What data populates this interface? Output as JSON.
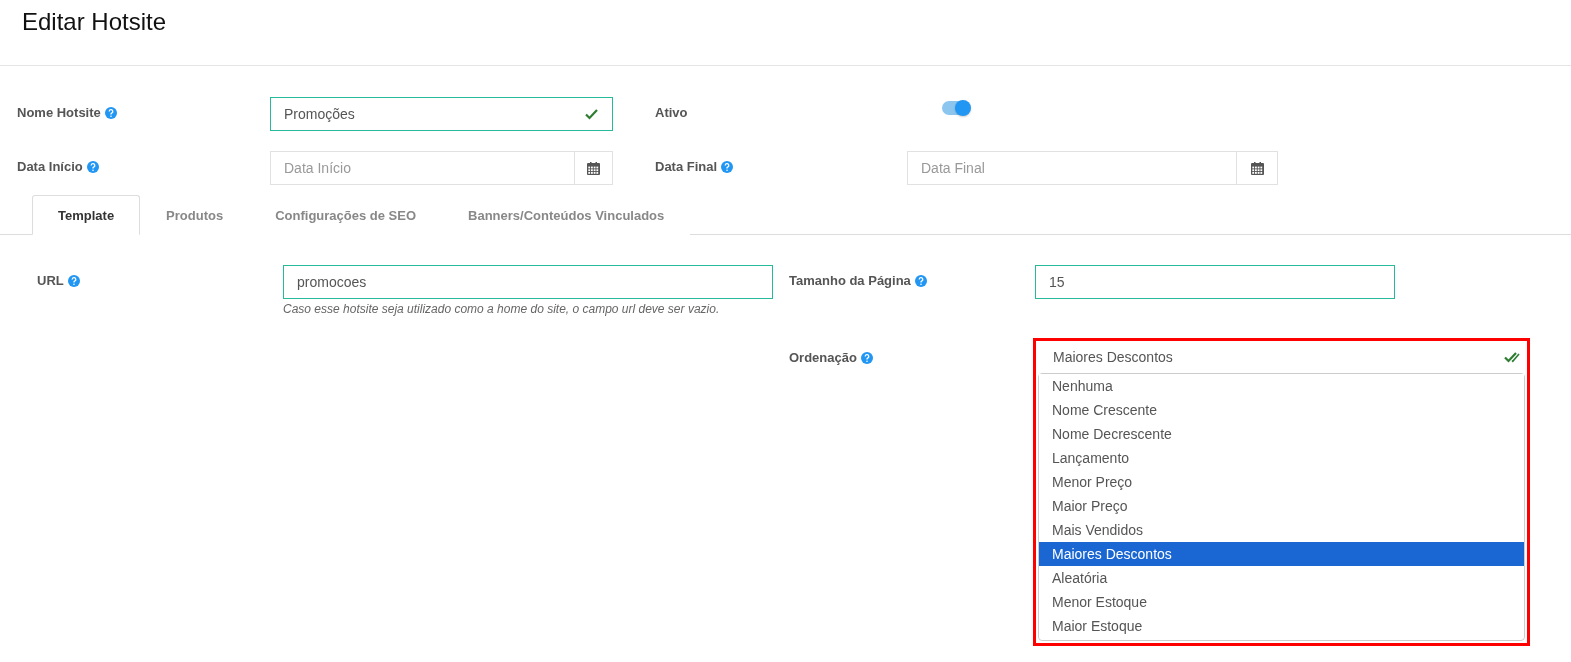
{
  "page_title": "Editar Hotsite",
  "fields": [
    {
      "kind": "text",
      "label": "Nome Hotsite",
      "help": true,
      "value": "Promoções",
      "valid": true
    },
    {
      "kind": "switch",
      "label": "Ativo",
      "help": false,
      "on": true
    },
    {
      "kind": "date",
      "label": "Data Início",
      "help": true,
      "placeholder": "Data Início"
    },
    {
      "kind": "date",
      "label": "Data Final",
      "help": true,
      "placeholder": "Data Final"
    }
  ],
  "tabs": [
    {
      "label": "Template",
      "selected": true
    },
    {
      "label": "Produtos",
      "selected": false
    },
    {
      "label": "Configurações de SEO",
      "selected": false
    },
    {
      "label": "Banners/Conteúdos Vinculados",
      "selected": false
    }
  ],
  "template": {
    "url": {
      "label": "URL",
      "value": "promocoes",
      "hint": "Caso esse hotsite seja utilizado como a home do site, o campo url deve ser vazio."
    },
    "page_size": {
      "label": "Tamanho da Página",
      "value": "15"
    },
    "ordering": {
      "label": "Ordenação",
      "value": "Maiores Descontos",
      "highlighted": true,
      "expanded": true,
      "options": [
        {
          "label": "Nenhuma",
          "selected": false
        },
        {
          "label": "Nome Crescente",
          "selected": false
        },
        {
          "label": "Nome Decrescente",
          "selected": false
        },
        {
          "label": "Lançamento",
          "selected": false
        },
        {
          "label": "Menor Preço",
          "selected": false
        },
        {
          "label": "Maior Preço",
          "selected": false
        },
        {
          "label": "Mais Vendidos",
          "selected": false
        },
        {
          "label": "Maiores Descontos",
          "selected": true
        },
        {
          "label": "Aleatória",
          "selected": false
        },
        {
          "label": "Menor Estoque",
          "selected": false
        },
        {
          "label": "Maior Estoque",
          "selected": false
        }
      ]
    }
  }
}
